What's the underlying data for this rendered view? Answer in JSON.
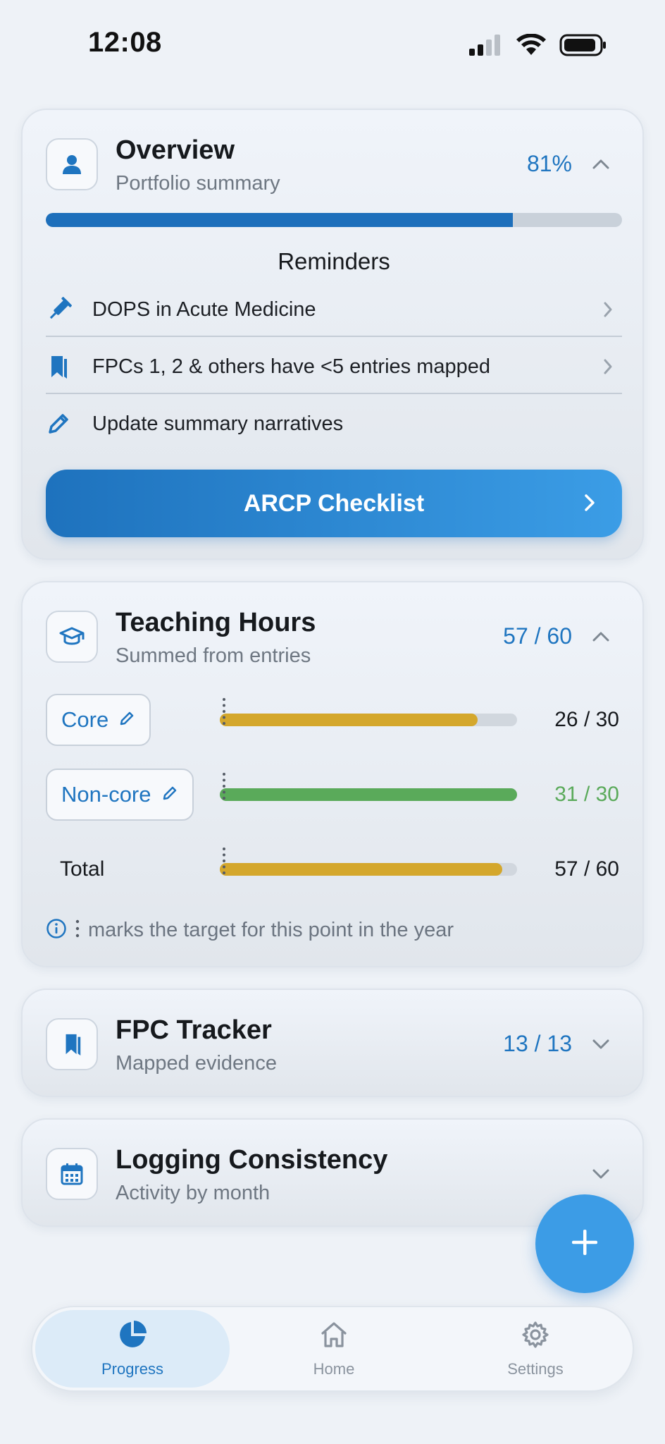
{
  "status_bar": {
    "time": "12:08"
  },
  "overview": {
    "title": "Overview",
    "subtitle": "Portfolio summary",
    "percent_label": "81%",
    "progress_fraction": 0.81,
    "icon": "person-icon",
    "reminders_heading": "Reminders",
    "reminders": [
      {
        "icon": "syringe-icon",
        "label": "DOPS in Acute Medicine",
        "has_chevron": true
      },
      {
        "icon": "bookmark-icon",
        "label": "FPCs 1, 2 & others have <5 entries mapped",
        "has_chevron": true
      },
      {
        "icon": "pencil-icon",
        "label": "Update summary narratives",
        "has_chevron": false
      }
    ],
    "checklist_button": "ARCP Checklist"
  },
  "teaching_hours": {
    "title": "Teaching Hours",
    "subtitle": "Summed from entries",
    "stat": "57 / 60",
    "icon": "graduation-cap-icon",
    "rows": [
      {
        "label": "Core",
        "value_text": "26 / 30",
        "value": 26,
        "target": 30,
        "color": "#d4a72c",
        "value_color": "#16191d",
        "editable": true
      },
      {
        "label": "Non-core",
        "value_text": "31 / 30",
        "value": 31,
        "target": 30,
        "color": "#5aaa5a",
        "value_color": "#5aaa5a",
        "editable": true
      },
      {
        "label": "Total",
        "value_text": "57 / 60",
        "value": 57,
        "target": 60,
        "color": "#d4a72c",
        "value_color": "#16191d",
        "editable": false
      }
    ],
    "legend_text": "marks the target for this point in the year"
  },
  "fpc_tracker": {
    "title": "FPC Tracker",
    "subtitle": "Mapped evidence",
    "stat": "13 / 13",
    "icon": "bookmark-icon"
  },
  "logging_consistency": {
    "title": "Logging Consistency",
    "subtitle": "Activity by month",
    "icon": "calendar-icon"
  },
  "tab_bar": {
    "tabs": [
      {
        "label": "Progress",
        "icon": "pie-chart-icon",
        "active": true
      },
      {
        "label": "Home",
        "icon": "home-icon",
        "active": false
      },
      {
        "label": "Settings",
        "icon": "gear-icon",
        "active": false
      }
    ]
  },
  "colors": {
    "accent": "#1f75c0",
    "fab": "#3c9ce6",
    "core_bar": "#d4a72c",
    "noncore_bar": "#5aaa5a"
  }
}
